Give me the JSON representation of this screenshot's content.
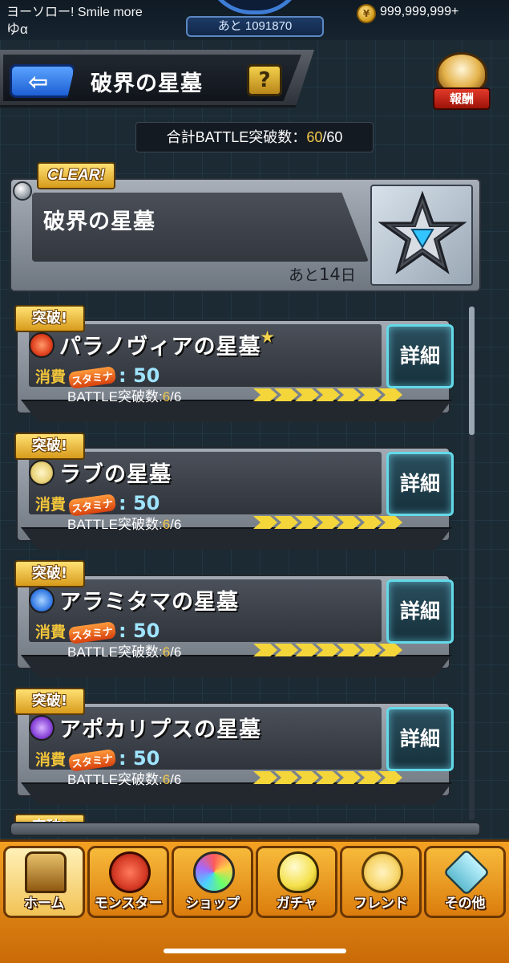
{
  "status": {
    "message": "ヨーソロー! Smile more",
    "username": "ゆα",
    "exp_remaining": "あと 1091870",
    "coins": "999,999,999+"
  },
  "header": {
    "title": "破界の星墓",
    "help_label": "?",
    "reward_label": "報酬"
  },
  "total": {
    "label": "合計BATTLE突破数：",
    "count": "60",
    "max": "/60"
  },
  "event": {
    "badge": "CLEAR!",
    "title": "破界の星墓",
    "remaining_prefix": "あと",
    "remaining_num": "14",
    "remaining_suffix": "日"
  },
  "stages": [
    {
      "badge": "突破!",
      "name": "パラノヴィアの星墓",
      "star": "★",
      "stamina_label": "消費",
      "stamina_icon": "スタミナ",
      "stamina_value": ": 50",
      "battle_label": "BATTLE突破数:",
      "battle_count": "6",
      "battle_max": "/6",
      "detail": "詳細",
      "progress": 1.0,
      "icon_color": "#e0411f"
    },
    {
      "badge": "突破!",
      "name": "ラブの星墓",
      "star": "",
      "stamina_label": "消費",
      "stamina_icon": "スタミナ",
      "stamina_value": ": 50",
      "battle_label": "BATTLE突破数:",
      "battle_count": "6",
      "battle_max": "/6",
      "detail": "詳細",
      "progress": 1.0,
      "icon_color": "#e9d27a"
    },
    {
      "badge": "突破!",
      "name": "アラミタマの星墓",
      "star": "",
      "stamina_label": "消費",
      "stamina_icon": "スタミナ",
      "stamina_value": ": 50",
      "battle_label": "BATTLE突破数:",
      "battle_count": "6",
      "battle_max": "/6",
      "detail": "詳細",
      "progress": 1.0,
      "icon_color": "#3a7fe6"
    },
    {
      "badge": "突破!",
      "name": "アポカリプスの星墓",
      "star": "",
      "stamina_label": "消費",
      "stamina_icon": "スタミナ",
      "stamina_value": ": 50",
      "battle_label": "BATTLE突破数:",
      "battle_count": "6",
      "battle_max": "/6",
      "detail": "詳細",
      "progress": 1.0,
      "icon_color": "#8a45d8"
    }
  ],
  "partial_badge": "突破!",
  "nav": [
    {
      "label": "ホーム",
      "icon": "home-icon",
      "color": "#c98a2a"
    },
    {
      "label": "モンスター",
      "icon": "monster-icon",
      "color": "#d53a25"
    },
    {
      "label": "ショップ",
      "icon": "shop-orb-icon",
      "color": "#9bd0ff"
    },
    {
      "label": "ガチャ",
      "icon": "gacha-egg-icon",
      "color": "#f4e04a"
    },
    {
      "label": "フレンド",
      "icon": "friend-icon",
      "color": "#f7d56a"
    },
    {
      "label": "その他",
      "icon": "other-icon",
      "color": "#5fbcd0"
    }
  ]
}
